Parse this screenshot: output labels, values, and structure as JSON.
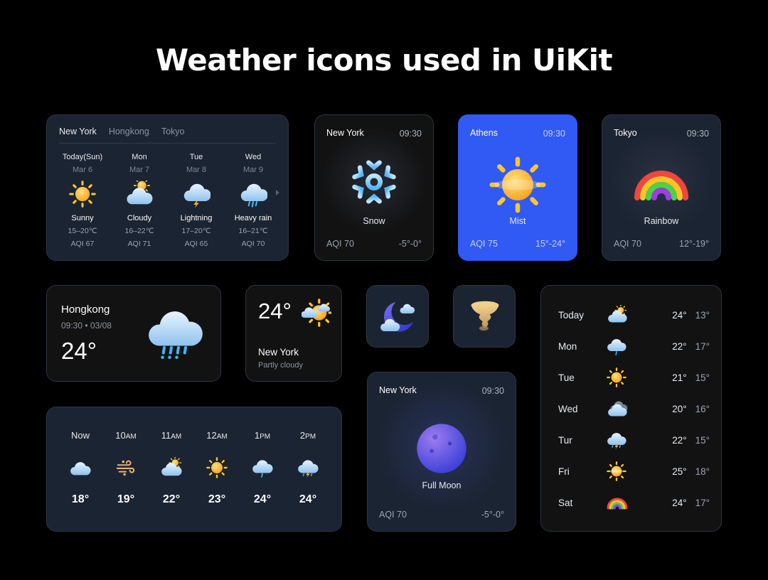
{
  "page": {
    "title": "Weather icons used in UiKit"
  },
  "forecast_card": {
    "tabs": [
      "New York",
      "Hongkong",
      "Tokyo"
    ],
    "active_tab": "New York",
    "days": [
      {
        "day": "Today(Sun)",
        "date": "Mar 6",
        "icon": "sunny-icon",
        "condition": "Sunny",
        "temp": "15–20℃",
        "aqi": "AQI 67"
      },
      {
        "day": "Mon",
        "date": "Mar 7",
        "icon": "cloudy-icon",
        "condition": "Cloudy",
        "temp": "16–22℃",
        "aqi": "AQI 71"
      },
      {
        "day": "Tue",
        "date": "Mar 8",
        "icon": "lightning-icon",
        "condition": "Lightning",
        "temp": "17–20℃",
        "aqi": "AQI 65"
      },
      {
        "day": "Wed",
        "date": "Mar 9",
        "icon": "heavy-rain-icon",
        "condition": "Heavy rain",
        "temp": "16–21℃",
        "aqi": "AQI 70"
      }
    ]
  },
  "snow_card": {
    "city": "New York",
    "time": "09:30",
    "icon": "snowflake-icon",
    "condition": "Snow",
    "aqi": "AQI 70",
    "range": "-5°-0°"
  },
  "mist_card": {
    "city": "Athens",
    "time": "09:30",
    "icon": "sun-icon",
    "condition": "Mist",
    "aqi": "AQI 75",
    "range": "15°-24°",
    "accent": "#3159f3"
  },
  "rainbow_card": {
    "city": "Tokyo",
    "time": "09:30",
    "icon": "rainbow-icon",
    "condition": "Rainbow",
    "aqi": "AQI 70",
    "range": "12°-19°"
  },
  "hongkong_card": {
    "city": "Hongkong",
    "meta": "09:30 • 03/08",
    "temp": "24°",
    "icon": "heavy-rain-icon"
  },
  "partly_card": {
    "temp": "24°",
    "city": "New York",
    "condition": "Partly cloudy",
    "icon": "partly-cloudy-icon"
  },
  "icon_tiles": [
    {
      "icon": "moon-cloud-icon"
    },
    {
      "icon": "tornado-icon"
    }
  ],
  "moon_card": {
    "city": "New York",
    "time": "09:30",
    "icon": "full-moon-icon",
    "condition": "Full Moon",
    "aqi": "AQI 70",
    "range": "-5°-0°"
  },
  "hourly_card": {
    "hours": [
      {
        "label": "Now",
        "suffix": "",
        "icon": "cloud-icon",
        "temp": "18°"
      },
      {
        "label": "10",
        "suffix": "AM",
        "icon": "wind-icon",
        "temp": "19°"
      },
      {
        "label": "11",
        "suffix": "AM",
        "icon": "partly-cloudy-icon",
        "temp": "22°"
      },
      {
        "label": "12",
        "suffix": "AM",
        "icon": "sun-icon",
        "temp": "23°"
      },
      {
        "label": "1",
        "suffix": "PM",
        "icon": "light-rain-icon",
        "temp": "24°"
      },
      {
        "label": "2",
        "suffix": "PM",
        "icon": "thunderstorm-icon",
        "temp": "24°"
      }
    ]
  },
  "weekly_card": {
    "rows": [
      {
        "day": "Today",
        "icon": "partly-cloudy-icon",
        "high": "24°",
        "low": "13°"
      },
      {
        "day": "Mon",
        "icon": "light-rain-icon",
        "high": "22°",
        "low": "17°"
      },
      {
        "day": "Tue",
        "icon": "sun-icon",
        "high": "21°",
        "low": "15°"
      },
      {
        "day": "Wed",
        "icon": "overcast-icon",
        "high": "20°",
        "low": "16°"
      },
      {
        "day": "Tur",
        "icon": "thunderstorm-icon",
        "high": "22°",
        "low": "15°"
      },
      {
        "day": "Fri",
        "icon": "hazy-sun-icon",
        "high": "25°",
        "low": "18°"
      },
      {
        "day": "Sat",
        "icon": "rainbow-icon",
        "high": "24°",
        "low": "17°"
      }
    ]
  }
}
